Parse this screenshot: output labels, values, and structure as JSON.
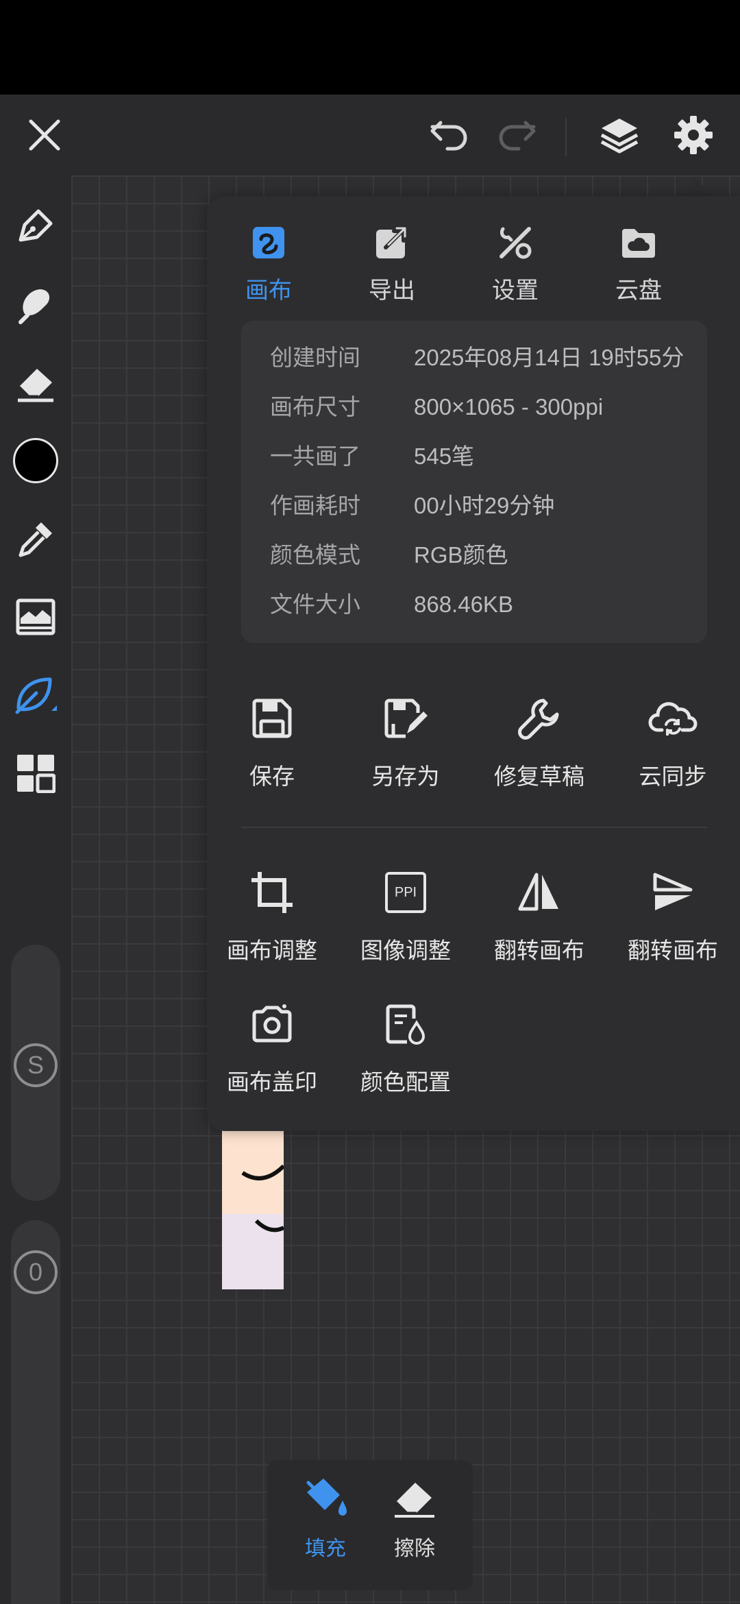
{
  "topbar": {
    "icons": [
      "close-icon",
      "undo-icon",
      "redo-icon",
      "layers-icon",
      "gear-icon"
    ]
  },
  "left_toolbar": {
    "tools": [
      "pen-icon",
      "smudge-icon",
      "eraser-icon",
      "color-swatch",
      "eyedropper-icon",
      "reference-image-icon",
      "leaf-brush-icon",
      "grid-apps-icon"
    ],
    "current_color": "#000000",
    "size_slider_label": "S",
    "opacity_slider_label": "0"
  },
  "menu": {
    "tabs": [
      {
        "label": "画布",
        "icon": "canvas-icon",
        "active": true
      },
      {
        "label": "导出",
        "icon": "export-icon",
        "active": false
      },
      {
        "label": "设置",
        "icon": "settings-tools-icon",
        "active": false
      },
      {
        "label": "云盘",
        "icon": "cloud-drive-icon",
        "active": false
      }
    ],
    "info": {
      "created": {
        "key": "创建时间",
        "value": "2025年08月14日 19时55分"
      },
      "size": {
        "key": "画布尺寸",
        "value": "800×1065 - 300ppi"
      },
      "strokes": {
        "key": "一共画了",
        "value": "545笔"
      },
      "time": {
        "key": "作画耗时",
        "value": "00小时29分钟"
      },
      "mode": {
        "key": "颜色模式",
        "value": "RGB颜色"
      },
      "file_size": {
        "key": "文件大小",
        "value": "868.46KB"
      }
    },
    "actions_row1": [
      {
        "label": "保存",
        "icon": "save-icon"
      },
      {
        "label": "另存为",
        "icon": "save-as-icon"
      },
      {
        "label": "修复草稿",
        "icon": "wrench-icon"
      },
      {
        "label": "云同步",
        "icon": "cloud-sync-icon"
      }
    ],
    "actions_row2": [
      {
        "label": "画布调整",
        "icon": "crop-icon"
      },
      {
        "label": "图像调整",
        "icon": "ppi-icon",
        "icon_text": "PPI"
      },
      {
        "label": "翻转画布",
        "icon": "flip-horizontal-icon"
      },
      {
        "label": "翻转画布",
        "icon": "flip-vertical-icon"
      }
    ],
    "actions_row3": [
      {
        "label": "画布盖印",
        "icon": "camera-icon"
      },
      {
        "label": "颜色配置",
        "icon": "color-profile-icon"
      }
    ]
  },
  "bottom_tools": [
    {
      "label": "填充",
      "icon": "fill-bucket-icon",
      "active": true
    },
    {
      "label": "擦除",
      "icon": "eraser-icon",
      "active": false
    }
  ],
  "colors": {
    "accent": "#3f93ee",
    "panel": "#2d2d2f",
    "toolbar": "#2a2a2c",
    "canvas_bg": "#2f2f31",
    "artwork_bg": "#fde3cf"
  }
}
